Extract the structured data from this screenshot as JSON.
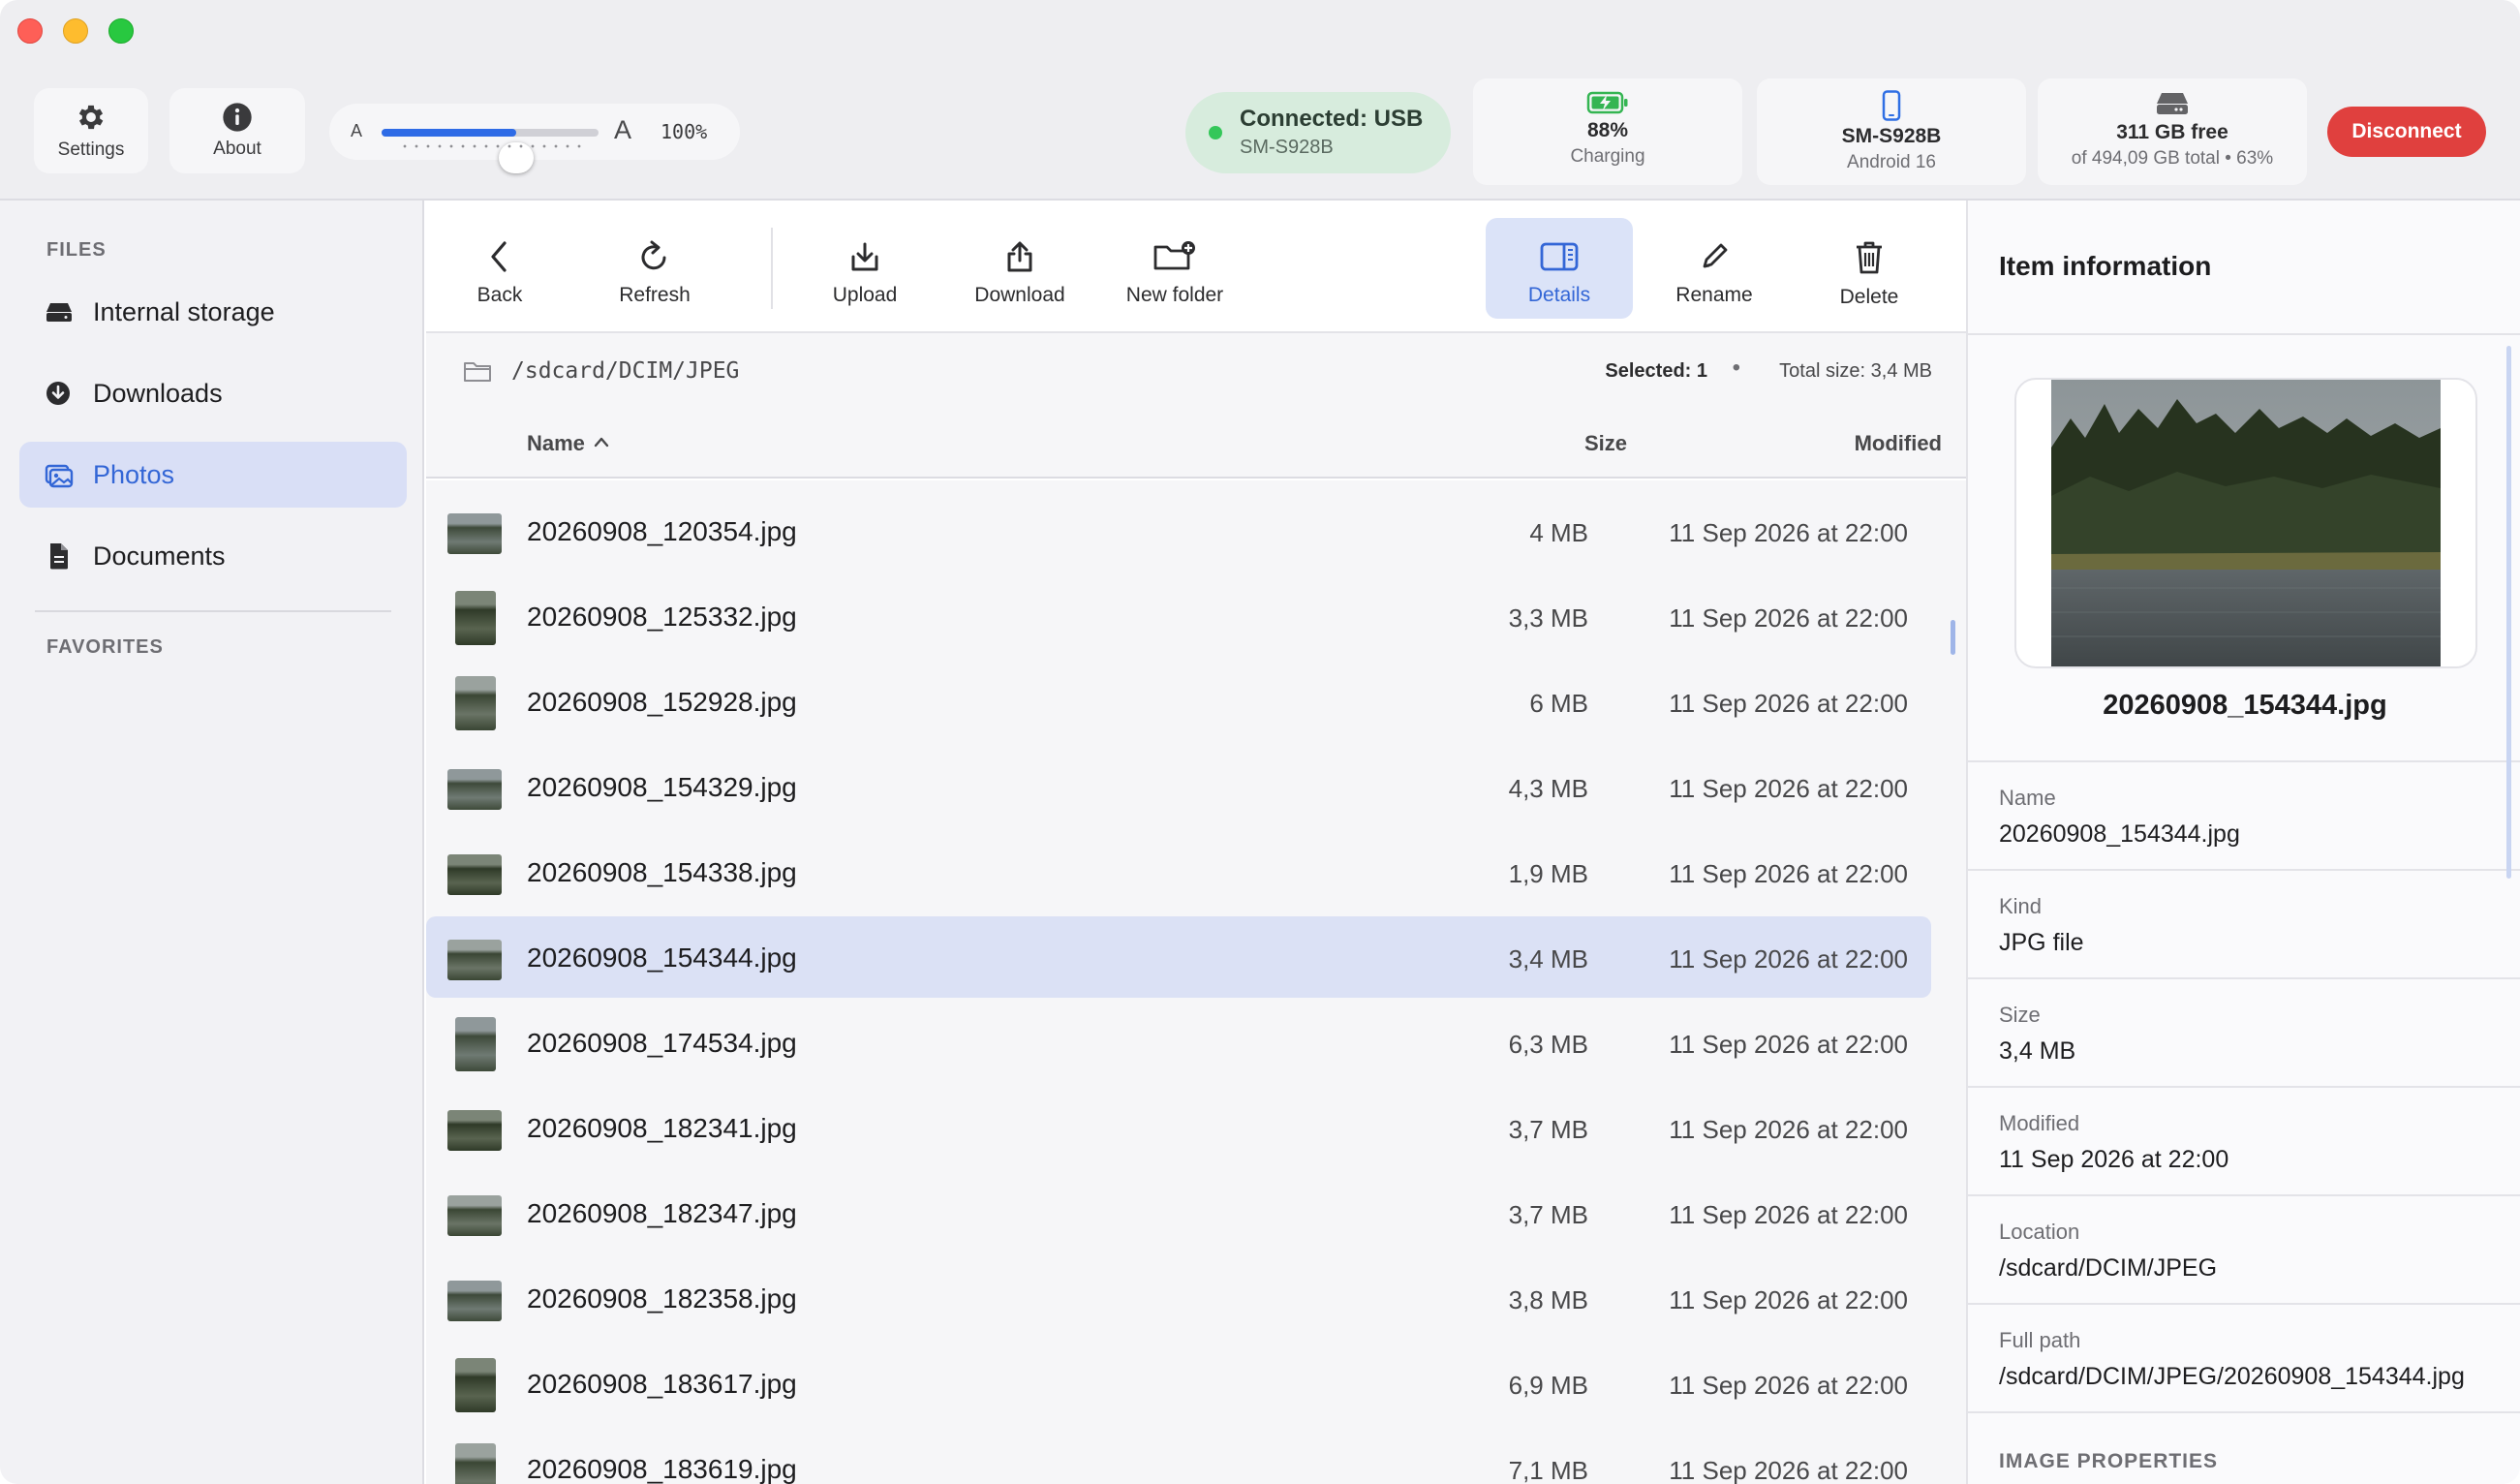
{
  "header": {
    "settings_label": "Settings",
    "about_label": "About",
    "zoom": {
      "small_a": "A",
      "large_a": "A",
      "percent_text": "100%",
      "level": 0.62
    },
    "connection": {
      "status": "Connected: USB",
      "device": "SM-S928B",
      "status_color": "#34c759"
    },
    "battery": {
      "value": "88%",
      "state": "Charging"
    },
    "device": {
      "model": "SM-S928B",
      "os": "Android 16"
    },
    "storage": {
      "free": "311 GB free",
      "detail": "of 494,09 GB total • 63%"
    },
    "disconnect_label": "Disconnect"
  },
  "sidebar": {
    "files_heading": "FILES",
    "favorites_heading": "FAVORITES",
    "items": [
      {
        "label": "Internal storage",
        "icon": "drive-icon",
        "active": false
      },
      {
        "label": "Downloads",
        "icon": "download-circle-icon",
        "active": false
      },
      {
        "label": "Photos",
        "icon": "photos-icon",
        "active": true
      },
      {
        "label": "Documents",
        "icon": "document-icon",
        "active": false
      }
    ]
  },
  "toolbar": {
    "back": "Back",
    "refresh": "Refresh",
    "upload": "Upload",
    "download": "Download",
    "new_folder": "New folder",
    "details": "Details",
    "rename": "Rename",
    "delete": "Delete"
  },
  "pathbar": {
    "path": "/sdcard/DCIM/JPEG",
    "selected": "Selected: 1",
    "separator": "•",
    "total": "Total size: 3,4 MB"
  },
  "columns": {
    "name": "Name",
    "size": "Size",
    "modified": "Modified"
  },
  "files": [
    {
      "name": "20260908_120354.jpg",
      "size": "4 MB",
      "modified": "11 Sep 2026 at 22:00",
      "orientation": "landscape",
      "selected": false
    },
    {
      "name": "20260908_125332.jpg",
      "size": "3,3 MB",
      "modified": "11 Sep 2026 at 22:00",
      "orientation": "portrait",
      "selected": false
    },
    {
      "name": "20260908_152928.jpg",
      "size": "6 MB",
      "modified": "11 Sep 2026 at 22:00",
      "orientation": "portrait",
      "selected": false
    },
    {
      "name": "20260908_154329.jpg",
      "size": "4,3 MB",
      "modified": "11 Sep 2026 at 22:00",
      "orientation": "landscape",
      "selected": false
    },
    {
      "name": "20260908_154338.jpg",
      "size": "1,9 MB",
      "modified": "11 Sep 2026 at 22:00",
      "orientation": "landscape",
      "selected": false
    },
    {
      "name": "20260908_154344.jpg",
      "size": "3,4 MB",
      "modified": "11 Sep 2026 at 22:00",
      "orientation": "landscape",
      "selected": true
    },
    {
      "name": "20260908_174534.jpg",
      "size": "6,3 MB",
      "modified": "11 Sep 2026 at 22:00",
      "orientation": "portrait",
      "selected": false
    },
    {
      "name": "20260908_182341.jpg",
      "size": "3,7 MB",
      "modified": "11 Sep 2026 at 22:00",
      "orientation": "landscape",
      "selected": false
    },
    {
      "name": "20260908_182347.jpg",
      "size": "3,7 MB",
      "modified": "11 Sep 2026 at 22:00",
      "orientation": "landscape",
      "selected": false
    },
    {
      "name": "20260908_182358.jpg",
      "size": "3,8 MB",
      "modified": "11 Sep 2026 at 22:00",
      "orientation": "landscape",
      "selected": false
    },
    {
      "name": "20260908_183617.jpg",
      "size": "6,9 MB",
      "modified": "11 Sep 2026 at 22:00",
      "orientation": "portrait",
      "selected": false
    },
    {
      "name": "20260908_183619.jpg",
      "size": "7,1 MB",
      "modified": "11 Sep 2026 at 22:00",
      "orientation": "portrait",
      "selected": false
    }
  ],
  "info": {
    "title": "Item information",
    "preview_name": "20260908_154344.jpg",
    "props": [
      {
        "key": "Name",
        "value": "20260908_154344.jpg"
      },
      {
        "key": "Kind",
        "value": "JPG file"
      },
      {
        "key": "Size",
        "value": "3,4 MB"
      },
      {
        "key": "Modified",
        "value": "11 Sep 2026 at 22:00"
      },
      {
        "key": "Location",
        "value": "/sdcard/DCIM/JPEG"
      },
      {
        "key": "Full path",
        "value": "/sdcard/DCIM/JPEG/20260908_154344.jpg"
      }
    ],
    "image_properties_heading": "IMAGE PROPERTIES"
  },
  "colors": {
    "accent": "#3366d6",
    "selection": "#dbe1f5",
    "disconnect": "#e0403e"
  }
}
